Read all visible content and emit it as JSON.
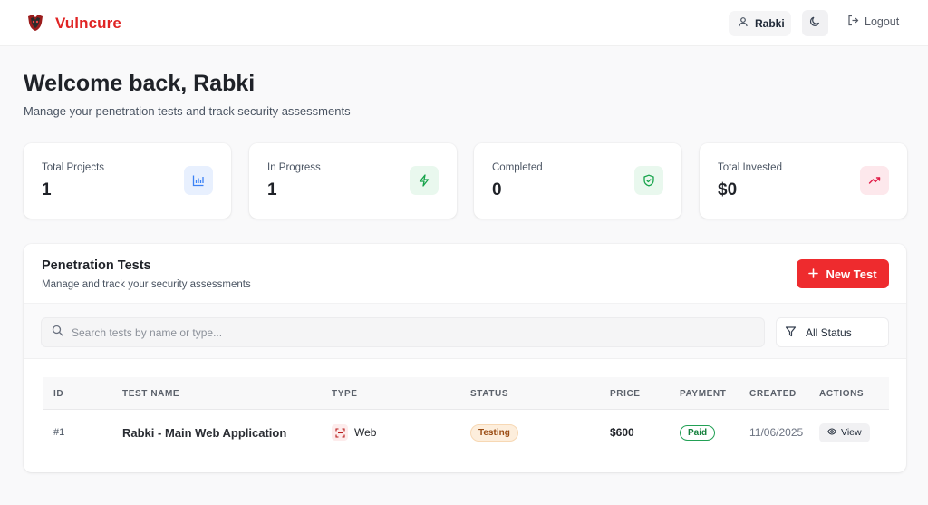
{
  "header": {
    "brand": "Vulncure",
    "user_name": "Rabki",
    "logout_label": "Logout"
  },
  "welcome": {
    "title": "Welcome back, Rabki",
    "subtitle": "Manage your penetration tests and track security assessments"
  },
  "stats": [
    {
      "label": "Total Projects",
      "value": "1",
      "icon": "bar-chart-icon",
      "accent": "#3b82f6"
    },
    {
      "label": "In Progress",
      "value": "1",
      "icon": "lightning-icon",
      "accent": "#22c55e"
    },
    {
      "label": "Completed",
      "value": "0",
      "icon": "shield-check-icon",
      "accent": "#16a34a"
    },
    {
      "label": "Total Invested",
      "value": "$0",
      "icon": "trending-up-icon",
      "accent": "#e11d48"
    }
  ],
  "panel": {
    "title": "Penetration Tests",
    "subtitle": "Manage and track your security assessments",
    "new_button": "New Test",
    "search_placeholder": "Search tests by name or type...",
    "filter_label": "All Status"
  },
  "table": {
    "columns": [
      "ID",
      "TEST NAME",
      "TYPE",
      "STATUS",
      "PRICE",
      "PAYMENT",
      "CREATED",
      "ACTIONS"
    ],
    "rows": [
      {
        "id": "#1",
        "name": "Rabki - Main Web Application",
        "type": "Web",
        "status": "Testing",
        "price": "$600",
        "payment": "Paid",
        "created": "11/06/2025",
        "action": "View"
      }
    ]
  },
  "colors": {
    "brand": "#e02424",
    "primary_button": "#ee2b2e",
    "status_testing": "#9a4b12",
    "payment_paid": "#15803d"
  }
}
